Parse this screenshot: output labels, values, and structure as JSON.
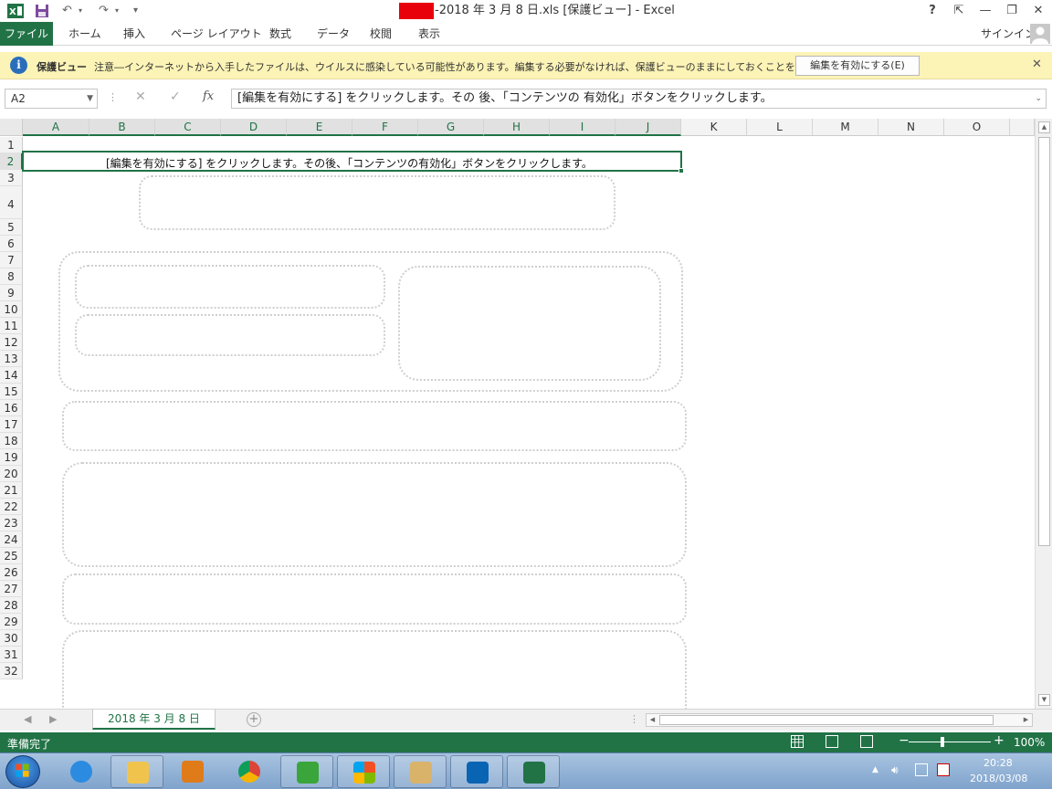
{
  "window": {
    "title_suffix": "-2018 年 3 月 8 日.xls  [保護ビュー] - Excel",
    "help": "?",
    "controls": {
      "ribbon_display": "⇱",
      "minimize": "—",
      "restore": "❐",
      "close": "✕"
    }
  },
  "quick_access": {
    "save_icon": "save-icon",
    "undo": "↶",
    "redo": "↷",
    "customize": "▾"
  },
  "ribbon": {
    "file_tab": "ファイル",
    "tabs": [
      "ホーム",
      "挿入",
      "ページ レイアウト",
      "数式",
      "データ",
      "校閲",
      "表示"
    ],
    "sign_in": "サインイン"
  },
  "protected_view": {
    "icon": "i",
    "title": "保護ビュー",
    "message": "注意―インターネットから入手したファイルは、ウイルスに感染している可能性があります。編集する必要がなければ、保護ビューのままにしておくことをお勧めします。",
    "enable_button": "編集を有効にする(E)",
    "close": "✕"
  },
  "formula_bar": {
    "name_box": "A2",
    "name_box_dropdown": "▼",
    "separator": "⋮",
    "cancel": "✕",
    "enter": "✓",
    "fx": "fx",
    "content": "[編集を有効にする] をクリックします。その 後、「コンテンツの 有効化」ボタンをクリックします。",
    "expand": "⌄"
  },
  "grid": {
    "columns": [
      "A",
      "B",
      "C",
      "D",
      "E",
      "F",
      "G",
      "H",
      "I",
      "J",
      "K",
      "L",
      "M",
      "N",
      "O"
    ],
    "selected_columns": [
      "A",
      "B",
      "C",
      "D",
      "E",
      "F",
      "G",
      "H",
      "I",
      "J"
    ],
    "rows": [
      "1",
      "2",
      "3",
      "4",
      "5",
      "6",
      "7",
      "8",
      "9",
      "10",
      "11",
      "12",
      "13",
      "14",
      "15",
      "16",
      "17",
      "18",
      "19",
      "20",
      "21",
      "22",
      "23",
      "24",
      "25",
      "26",
      "27",
      "28",
      "29",
      "30",
      "31",
      "32"
    ],
    "selected_row": "2",
    "cell_a2": "[編集を有効にする] をクリックします。その後、「コンテンツの有効化」ボタンをクリックします。"
  },
  "scrollbar": {
    "up": "▲",
    "down": "▼",
    "left": "◀",
    "right": "▶"
  },
  "sheets": {
    "nav_prev": "◀",
    "nav_next": "▶",
    "active": "2018 年 3 月 8 日",
    "add": "+",
    "separator": "⋮"
  },
  "status": {
    "ready": "準備完了",
    "zoom_minus": "−",
    "zoom_plus": "+",
    "zoom": "100%",
    "zoom_value": 100
  },
  "taskbar": {
    "apps": [
      "ie-icon",
      "explorer-icon",
      "media-player-icon",
      "chrome-icon",
      "shark-app-icon",
      "windows-app-icon",
      "folder-app-icon",
      "outlook-icon",
      "excel-icon"
    ],
    "time": "20:28",
    "date": "2018/03/08"
  },
  "colors": {
    "excel_green": "#217346",
    "pv_bar": "#fcf3b6",
    "redaction": "#e8000b",
    "taskbar": "#7fa3cc"
  }
}
